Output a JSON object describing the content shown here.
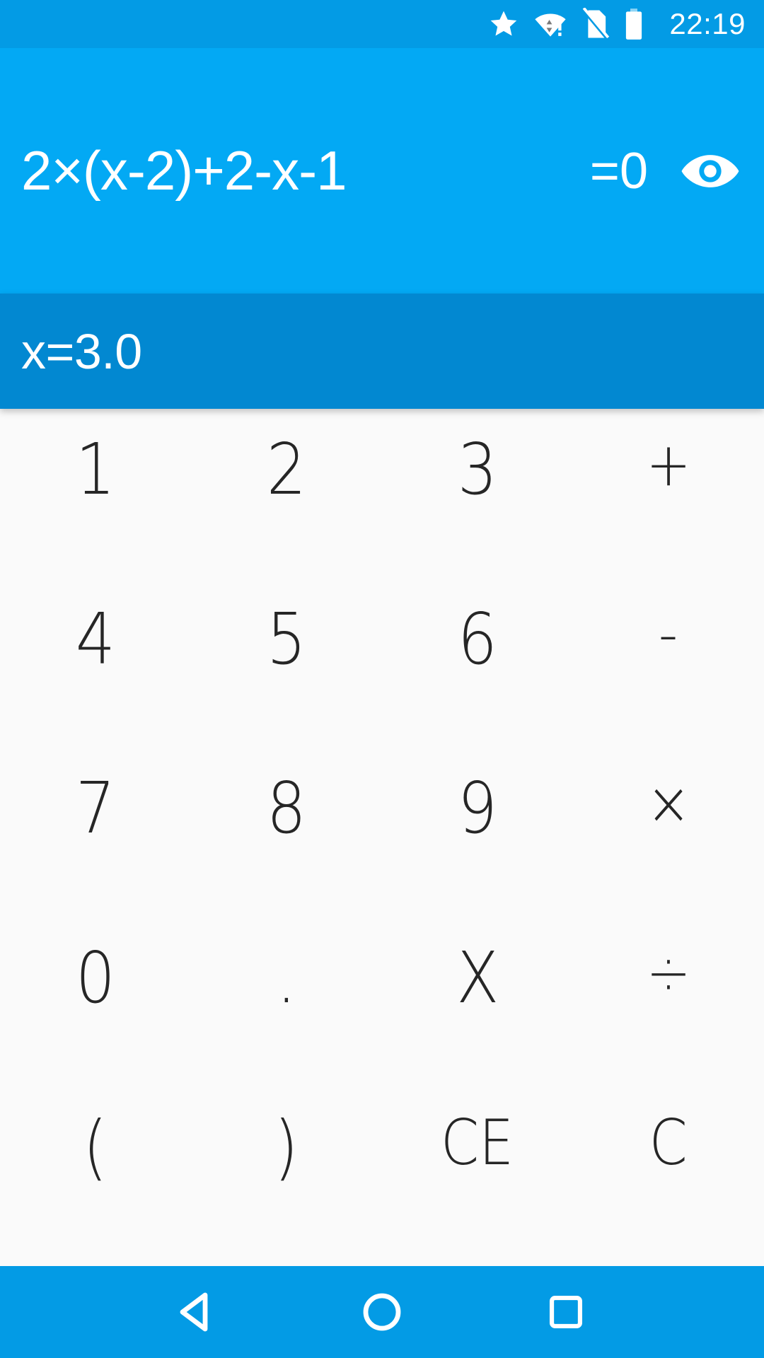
{
  "status_bar": {
    "time": "22:19",
    "icons": [
      {
        "name": "star-icon",
        "label": "star"
      },
      {
        "name": "wifi-warning-icon",
        "label": "wifi-no-internet"
      },
      {
        "name": "no-sim-icon",
        "label": "no-sim-card"
      },
      {
        "name": "battery-icon",
        "label": "battery-full"
      }
    ]
  },
  "display": {
    "expression": "2×(x-2)+2-x-1",
    "equals": "=0",
    "visibility_icon": "eye-icon",
    "result": "x=3.0"
  },
  "keypad": {
    "rows": [
      [
        {
          "label": "1",
          "name": "key-1",
          "kind": "digit"
        },
        {
          "label": "2",
          "name": "key-2",
          "kind": "digit"
        },
        {
          "label": "3",
          "name": "key-3",
          "kind": "digit"
        },
        {
          "label": "+",
          "name": "key-plus",
          "kind": "op"
        }
      ],
      [
        {
          "label": "4",
          "name": "key-4",
          "kind": "digit"
        },
        {
          "label": "5",
          "name": "key-5",
          "kind": "digit"
        },
        {
          "label": "6",
          "name": "key-6",
          "kind": "digit"
        },
        {
          "label": "-",
          "name": "key-minus",
          "kind": "op"
        }
      ],
      [
        {
          "label": "7",
          "name": "key-7",
          "kind": "digit"
        },
        {
          "label": "8",
          "name": "key-8",
          "kind": "digit"
        },
        {
          "label": "9",
          "name": "key-9",
          "kind": "digit"
        },
        {
          "label": "×",
          "name": "key-multiply",
          "kind": "op"
        }
      ],
      [
        {
          "label": "0",
          "name": "key-0",
          "kind": "digit"
        },
        {
          "label": ".",
          "name": "key-decimal",
          "kind": "dot"
        },
        {
          "label": "X",
          "name": "key-variable-x",
          "kind": "digit"
        },
        {
          "label": "÷",
          "name": "key-divide",
          "kind": "op"
        }
      ],
      [
        {
          "label": "(",
          "name": "key-open-paren",
          "kind": "digit"
        },
        {
          "label": ")",
          "name": "key-close-paren",
          "kind": "digit"
        },
        {
          "label": "CE",
          "name": "key-clear-entry",
          "kind": "small-txt"
        },
        {
          "label": "C",
          "name": "key-clear",
          "kind": "small-txt"
        }
      ]
    ]
  },
  "nav_bar": {
    "back": "back-icon",
    "home": "home-icon",
    "recents": "recents-icon"
  },
  "colors": {
    "status_bar": "#039BE5",
    "header": "#03A9F4",
    "result_bar": "#0288D1",
    "keypad_bg": "#FAFAFA",
    "key_text": "#262626",
    "on_blue_text": "#FFFFFF"
  }
}
